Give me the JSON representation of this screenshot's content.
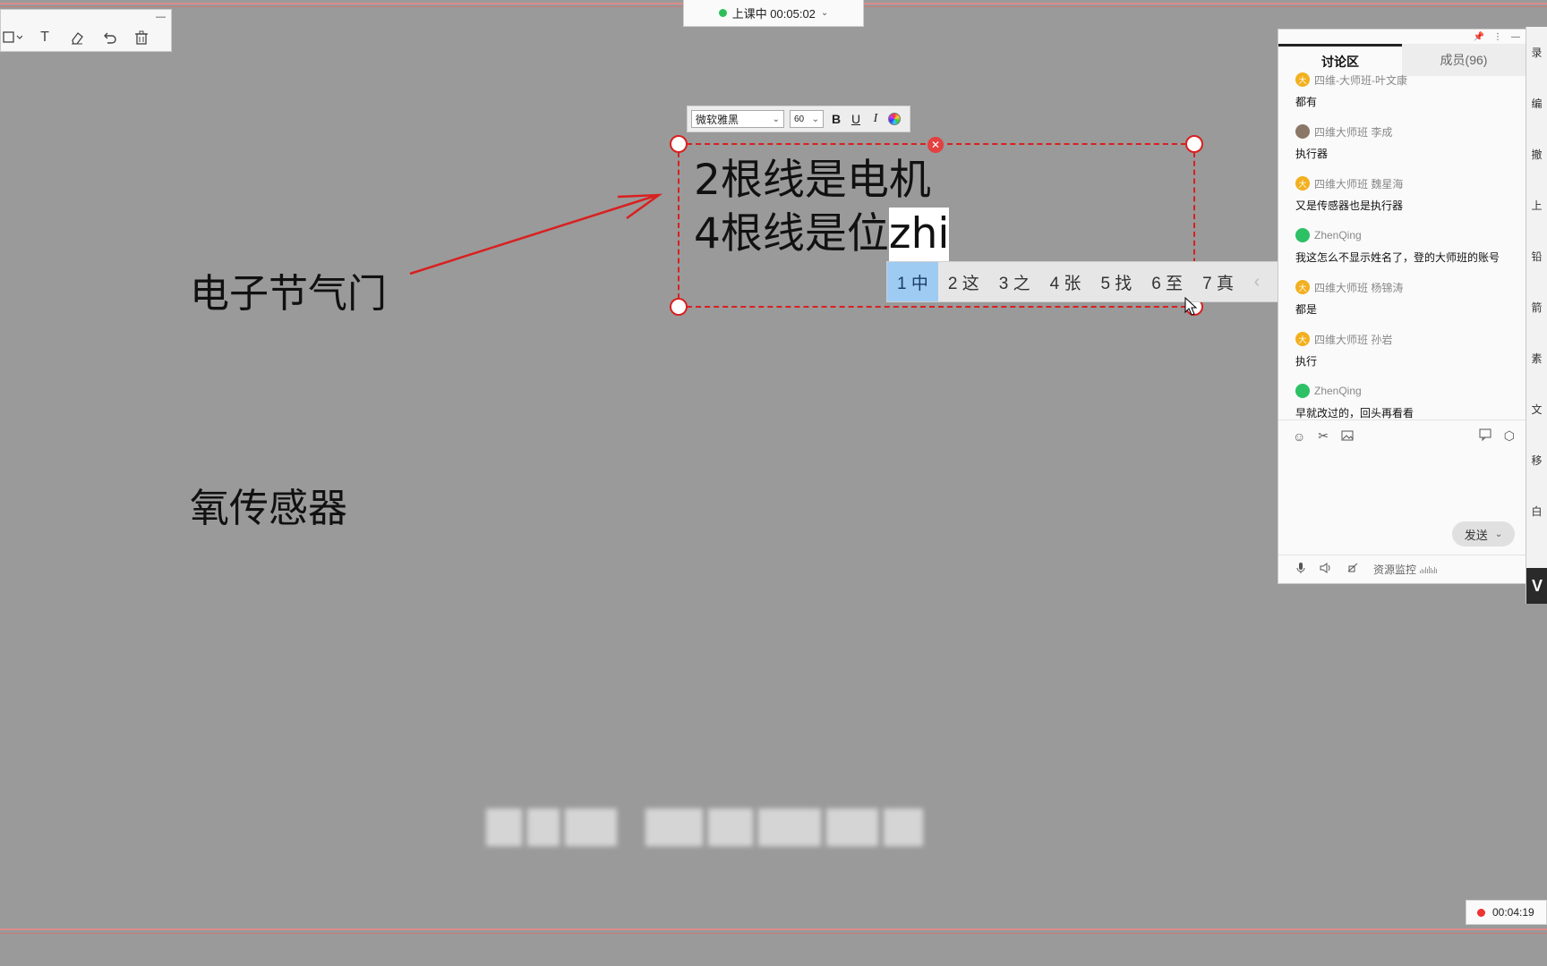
{
  "class_status": {
    "label": "上课中 00:05:02"
  },
  "draw_toolbar": {
    "minimize": "—",
    "text_tool": "T"
  },
  "canvas": {
    "label_throttle": "电子节气门",
    "label_oxygen": "氧传感器"
  },
  "text_editor": {
    "font": "微软雅黑",
    "size": "60",
    "bold": "B",
    "underline": "U",
    "italic": "I",
    "line1": "2根线是电机",
    "line2_committed": "4根线是位",
    "line2_composing": "zhi",
    "close": "✕"
  },
  "ime": {
    "candidates": [
      "1 中",
      "2 这",
      "3 之",
      "4 张",
      "5 找",
      "6 至",
      "7 真"
    ],
    "prev": "‹",
    "next": "›",
    "emoji": "☺"
  },
  "chat": {
    "tabs": [
      "讨论区",
      "成员(96)"
    ],
    "messages": [
      {
        "user": "四维-大师班-叶文康",
        "text": "都有",
        "avatar": "gold",
        "avatar_char": "大"
      },
      {
        "user": "四维大师班 李成",
        "text": "执行器",
        "avatar": "photo",
        "avatar_char": ""
      },
      {
        "user": "四维大师班 魏星海",
        "text": "又是传感器也是执行器",
        "avatar": "gold",
        "avatar_char": "大"
      },
      {
        "user": "ZhenQing",
        "text": "我这怎么不显示姓名了，登的大师班的账号",
        "avatar": "wechat",
        "avatar_char": ""
      },
      {
        "user": "四维大师班 杨锦涛",
        "text": "都是",
        "avatar": "gold",
        "avatar_char": "大"
      },
      {
        "user": "四维大师班 孙岩",
        "text": "执行",
        "avatar": "gold",
        "avatar_char": "大"
      },
      {
        "user": "ZhenQing",
        "text": "早就改过的，回头再看看",
        "avatar": "wechat",
        "avatar_char": ""
      }
    ],
    "send_label": "发送",
    "monitor_label": "资源监控"
  },
  "side_strip": {
    "items": [
      "录",
      "编",
      "撤",
      "上",
      "铅",
      "箭",
      "素",
      "文",
      "移",
      "白"
    ],
    "logo": "V"
  },
  "rec_timer": {
    "label": "00:04:19"
  },
  "colors": {
    "accent_red": "#d92020",
    "ime_selected": "#9ecbf2",
    "status_green": "#2fbf5a"
  }
}
